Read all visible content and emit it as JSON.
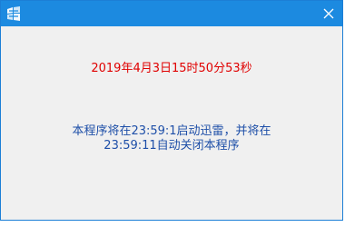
{
  "window": {
    "accent_color": "#1c8ae0",
    "icon": "app-logo-icon",
    "close_icon": "close-icon"
  },
  "content": {
    "datetime": "2019年4月3日15时50分53秒",
    "message_line1": "本程序将在23:59:1启动迅雷，并将在",
    "message_line2": "23:59:11自动关闭本程序"
  }
}
